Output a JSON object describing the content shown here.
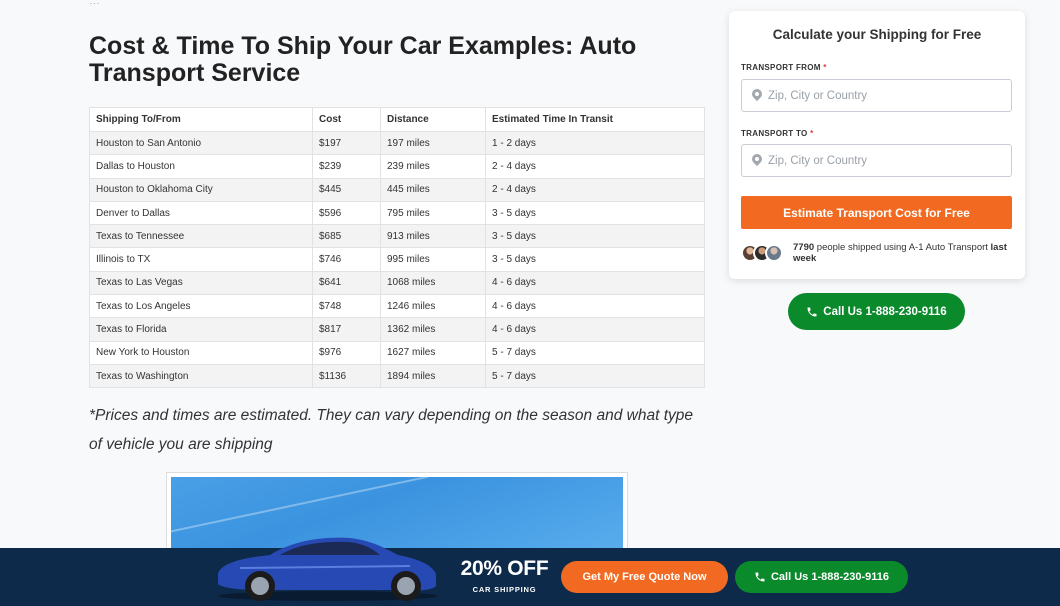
{
  "article": {
    "top_fragment": "...",
    "headline": "Cost & Time To Ship Your Car Examples: Auto Transport Service",
    "table": {
      "headers": [
        "Shipping To/From",
        "Cost",
        "Distance",
        "Estimated Time In Transit"
      ],
      "rows": [
        [
          "Houston to San Antonio",
          "$197",
          "197 miles",
          "1 - 2 days"
        ],
        [
          "Dallas to Houston",
          "$239",
          "239 miles",
          "2 - 4 days"
        ],
        [
          "Houston to Oklahoma City",
          "$445",
          "445 miles",
          "2 - 4 days"
        ],
        [
          "Denver to Dallas",
          "$596",
          "795 miles",
          "3 - 5 days"
        ],
        [
          "Texas to Tennessee",
          "$685",
          "913 miles",
          "3 - 5 days"
        ],
        [
          "Illinois to TX",
          "$746",
          "995 miles",
          "3 - 5 days"
        ],
        [
          "Texas to Las Vegas",
          "$641",
          "1068 miles",
          "4 - 6 days"
        ],
        [
          "Texas to Los Angeles",
          "$748",
          "1246 miles",
          "4 - 6 days"
        ],
        [
          "Texas to Florida",
          "$817",
          "1362 miles",
          "4 - 6 days"
        ],
        [
          "New York to Houston",
          "$976",
          "1627 miles",
          "5 - 7 days"
        ],
        [
          "Texas to Washington",
          "$1136",
          "1894 miles",
          "5 - 7 days"
        ]
      ]
    },
    "note": "*Prices and times are estimated. They can vary depending on the season and what type of vehicle you are shipping"
  },
  "quote_card": {
    "title": "Calculate your Shipping for Free",
    "from_label": "TRANSPORT FROM",
    "to_label": "TRANSPORT TO",
    "required_mark": "*",
    "from_placeholder": "Zip, City or Country",
    "to_placeholder": "Zip, City or Country",
    "from_value": "",
    "to_value": "",
    "submit_label": "Estimate Transport Cost for Free",
    "social_count": "7790",
    "social_text": "people shipped using A-1 Auto Transport",
    "social_period": "last week",
    "icons": [
      "map-pin-icon",
      "phone-icon"
    ]
  },
  "call_button": {
    "label": "Call Us 1-888-230-9116"
  },
  "promo_bar": {
    "discount": "20% OFF",
    "subtitle": "CAR SHIPPING",
    "quote_label": "Get My Free Quote Now",
    "call_label": "Call Us 1-888-230-9116"
  },
  "colors": {
    "accent_orange": "#f26a21",
    "call_green": "#0b8a2c",
    "promo_navy": "#0e2a4a"
  }
}
